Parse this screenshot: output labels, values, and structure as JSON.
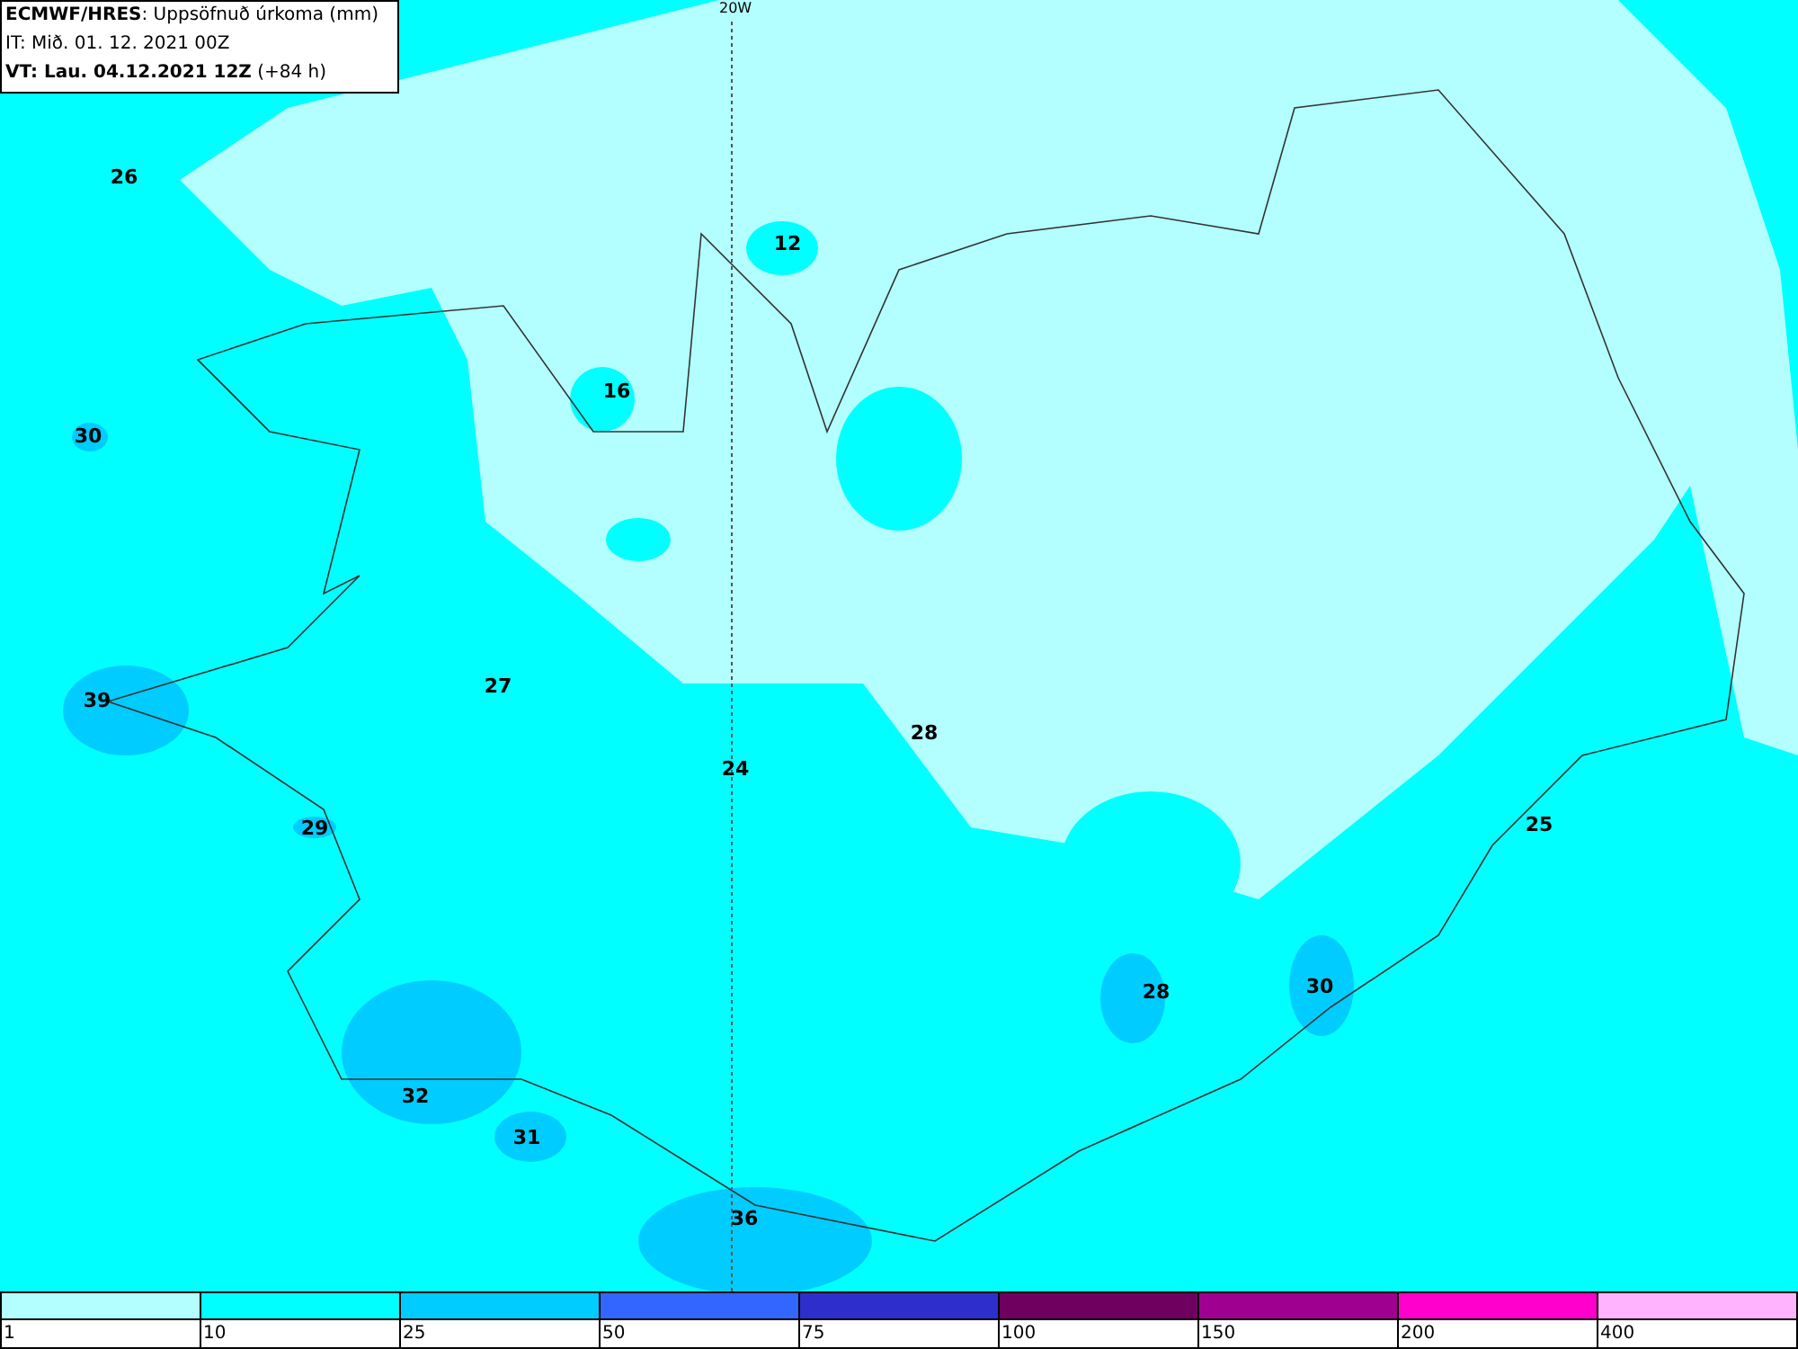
{
  "header": {
    "lines": [
      "**ECMWF/HRES**: Uppsöfnuð úrkoma (mm)",
      "IT: Mið. 01. 12. 2021 00Z",
      "**VT: Lau. 04.12.2021 12Z** (+84 h)"
    ]
  },
  "meridian_label": "20W",
  "map_values": [
    "26",
    "12",
    "16",
    "30",
    "39",
    "27",
    "28",
    "24",
    "29",
    "25",
    "28",
    "30",
    "32",
    "31",
    "36"
  ],
  "legend": {
    "bins": [
      {
        "color": "#b3ffff"
      },
      {
        "color": "#00ffff"
      },
      {
        "color": "#00ccff"
      },
      {
        "color": "#3366ff"
      },
      {
        "color": "#2e2ecc"
      },
      {
        "color": "#700060"
      },
      {
        "color": "#a0008f"
      },
      {
        "color": "#ff00cc"
      },
      {
        "color": "#ffb3ff"
      }
    ],
    "ticks": [
      "1",
      "10",
      "25",
      "50",
      "75",
      "100",
      "150",
      "200",
      "400"
    ]
  }
}
